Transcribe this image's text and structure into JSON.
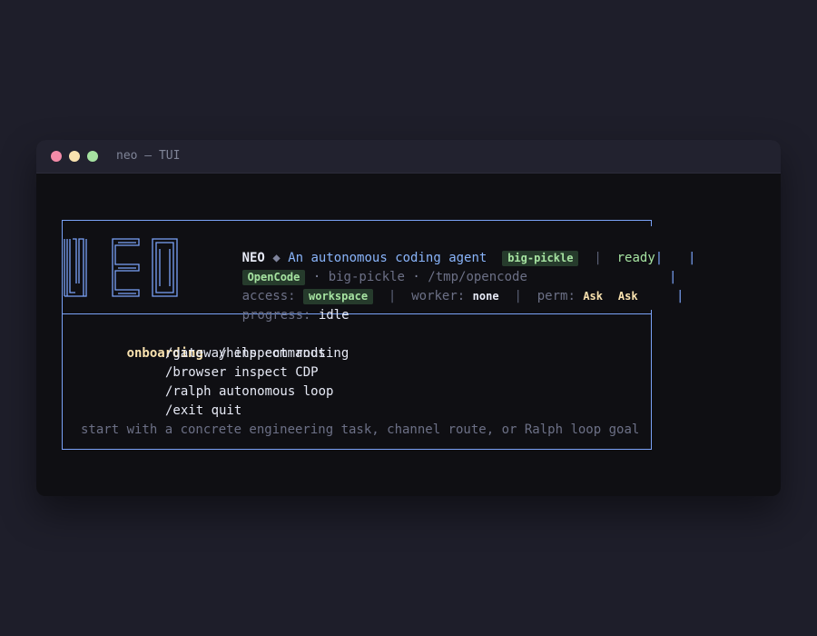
{
  "window": {
    "title": "neo — TUI"
  },
  "header": {
    "name": "NEO",
    "diamond": "◆",
    "tagline": "An autonomous coding agent",
    "model_badge": "big-pickle",
    "status": "ready",
    "provider_badge": "OpenCode",
    "model_name": "big-pickle",
    "workdir": "/tmp/opencode",
    "access_label": "access:",
    "access_value": "workspace",
    "worker_label": "worker:",
    "worker_value": "none",
    "perm_label": "perm:",
    "perm_value_1": "Ask",
    "perm_value_2": "Ask",
    "progress_label": "progress:",
    "progress_value": "idle",
    "separator": "|",
    "dot_sep": "·"
  },
  "onboarding": {
    "heading": "onboarding",
    "commands": [
      "/help commands",
      "/gateway inspect routing",
      "/browser inspect CDP",
      "/ralph autonomous loop",
      "/exit quit"
    ],
    "hint": "start with a concrete engineering task, channel route, or Ralph loop goal"
  },
  "colors": {
    "frame": "#7aa2f7",
    "badge_bg": "#263b2c",
    "badge_fg": "#a6e3a1",
    "heading": "#f9e2af"
  }
}
